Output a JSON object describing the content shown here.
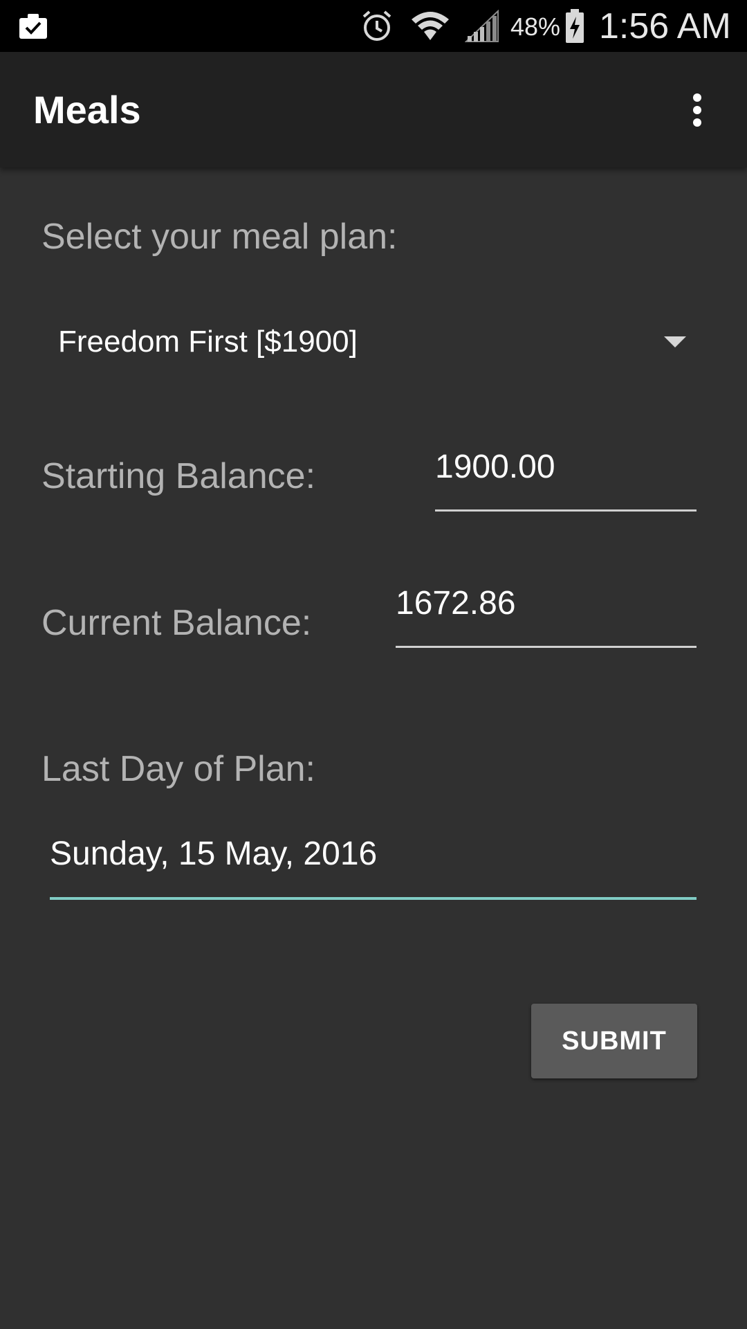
{
  "status_bar": {
    "battery_percent": "48%",
    "time": "1:56 AM",
    "icons": [
      "clipboard-check-icon",
      "alarm-icon",
      "wifi-icon",
      "signal-icon",
      "battery-charging-icon"
    ]
  },
  "app_bar": {
    "title": "Meals",
    "overflow_icon": "more-vert-icon"
  },
  "form": {
    "meal_plan_label": "Select your meal plan:",
    "meal_plan_selected": "Freedom First [$1900]",
    "starting_balance_label": "Starting Balance:",
    "starting_balance_value": "1900.00",
    "current_balance_label": "Current Balance:",
    "current_balance_value": "1672.86",
    "last_day_label": "Last Day of Plan:",
    "last_day_value": "Sunday, 15 May, 2016",
    "submit_label": "SUBMIT"
  },
  "colors": {
    "background": "#303030",
    "app_bar": "#212121",
    "status_bar": "#000000",
    "accent_underline": "#80cbc4",
    "button": "#5a5a5a"
  }
}
